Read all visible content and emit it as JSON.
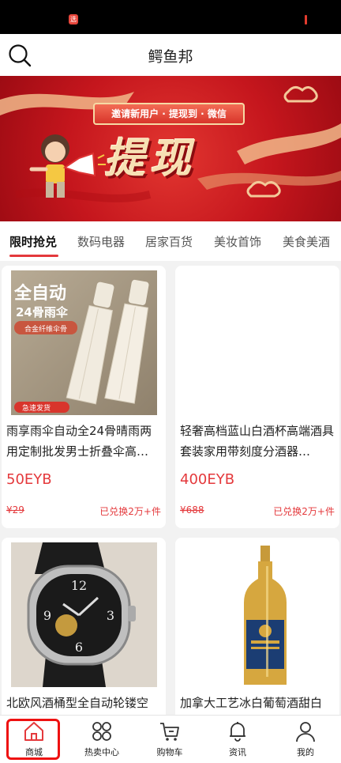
{
  "status_bar": {
    "app_icon": "选"
  },
  "header": {
    "title": "鳄鱼邦",
    "search_icon": "search-icon"
  },
  "banner": {
    "ribbon_text": "邀请新用户 · 提现到 · 微信",
    "title": "提现"
  },
  "tabs": [
    {
      "label": "限时抢兑",
      "active": true
    },
    {
      "label": "数码电器"
    },
    {
      "label": "居家百货"
    },
    {
      "label": "美妆首饰"
    },
    {
      "label": "美食美酒"
    }
  ],
  "products": [
    {
      "name": "雨享雨伞自动全24骨晴雨两用定制批发男士折叠伞高…",
      "price": "50EYB",
      "original": "¥29",
      "sold": "已兑换2万+件",
      "image_text": {
        "line1": "全自动",
        "line2": "24骨雨伞",
        "tag": "合金纤维伞骨",
        "badge": "急速发货"
      }
    },
    {
      "name": "轻奢高档蓝山白酒杯高端酒具套装家用带刻度分酒器…",
      "price": "400EYB",
      "original": "¥688",
      "sold": "已兑换2万+件"
    },
    {
      "name": "北欧风酒桶型全自动轮镂空",
      "price": "",
      "original": "",
      "sold": ""
    },
    {
      "name": "加拿大工艺冰白葡萄酒甜白",
      "price": "",
      "original": "",
      "sold": ""
    }
  ],
  "bottom_nav": [
    {
      "label": "商城",
      "icon": "home-icon",
      "active": true
    },
    {
      "label": "热卖中心",
      "icon": "grid-icon"
    },
    {
      "label": "购物车",
      "icon": "cart-icon"
    },
    {
      "label": "资讯",
      "icon": "bell-icon"
    },
    {
      "label": "我的",
      "icon": "user-icon"
    }
  ],
  "colors": {
    "accent": "#e4393c",
    "banner": "#c5161d",
    "gold": "#f7e0b3"
  }
}
